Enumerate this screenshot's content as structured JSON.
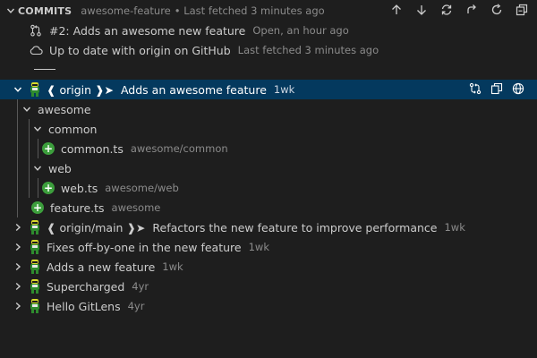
{
  "header": {
    "title": "COMMITS",
    "branch": "awesome-feature",
    "fetched": "• Last fetched 3 minutes ago"
  },
  "pr": {
    "text": "#2: Adds an awesome new feature",
    "meta": "Open, an hour ago"
  },
  "sync": {
    "text": "Up to date with origin on GitHub",
    "meta": "Last fetched 3 minutes ago"
  },
  "selected_commit": {
    "branch_label": "❰ origin ❱➤",
    "message": "Adds an awesome feature",
    "age": "1wk"
  },
  "tree": {
    "folder_awesome": "awesome",
    "folder_common": "common",
    "file_common": {
      "name": "common.ts",
      "path": "awesome/common"
    },
    "folder_web": "web",
    "file_web": {
      "name": "web.ts",
      "path": "awesome/web"
    },
    "file_feature": {
      "name": "feature.ts",
      "path": "awesome"
    }
  },
  "commits": [
    {
      "branch_label": "❰ origin/main ❱➤",
      "message": "Refactors the new feature to improve performance",
      "age": "1wk"
    },
    {
      "message": "Fixes off-by-one in the new feature",
      "age": "1wk"
    },
    {
      "message": "Adds a new feature",
      "age": "1wk"
    },
    {
      "message": "Supercharged",
      "age": "4yr"
    },
    {
      "message": "Hello GitLens",
      "age": "4yr"
    }
  ],
  "colors": {
    "selection": "#04395e",
    "added_badge": "#3c9e3c",
    "background": "#1e1e1e"
  }
}
